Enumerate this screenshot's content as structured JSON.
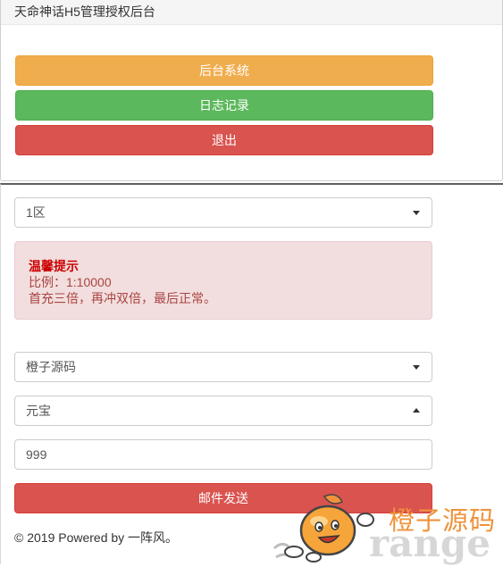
{
  "header": {
    "title": "天命神话H5管理授权后台"
  },
  "actions": {
    "admin_label": "后台系统",
    "log_label": "日志记录",
    "logout_label": "退出"
  },
  "form": {
    "server_select": "1区",
    "notice": {
      "title": "温馨提示",
      "ratio": "比例：1:10000",
      "text": "首充三倍，再冲双倍，最后正常。"
    },
    "player_select": "橙子源码",
    "item_select": "元宝",
    "amount_value": "999",
    "send_label": "邮件发送"
  },
  "footer": {
    "text": "© 2019 Powered by 一阵风。"
  },
  "watermark": {
    "cn": "橙子源码",
    "en": "range"
  },
  "colors": {
    "warning": "#f0ad4e",
    "success": "#5cb85c",
    "danger": "#d9534f",
    "alert_bg": "#f2dede",
    "alert_text": "#a94442"
  }
}
